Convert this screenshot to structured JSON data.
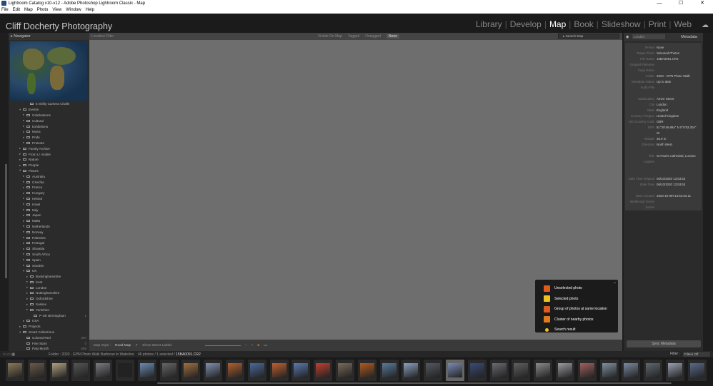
{
  "window": {
    "title": "Lightroom Catalog v10-v12 - Adobe Photoshop Lightroom Classic - Map",
    "controls": [
      "—",
      "☐",
      "✕"
    ]
  },
  "menu": [
    "File",
    "Edit",
    "Map",
    "Photo",
    "View",
    "Window",
    "Help"
  ],
  "identity_plate": "Cliff Docherty Photography",
  "modules": [
    "Library",
    "Develop",
    "Map",
    "Book",
    "Slideshow",
    "Print",
    "Web"
  ],
  "active_module": "Map",
  "left_panel": {
    "navigator_label": "Navigator",
    "tree": [
      {
        "label": "5 Shifty Camera Challe",
        "indent": 3,
        "twisty": ""
      },
      {
        "label": "Events",
        "indent": 1,
        "twisty": "▾"
      },
      {
        "label": "Celebrations",
        "indent": 2,
        "twisty": "▸"
      },
      {
        "label": "Cultural",
        "indent": 2,
        "twisty": "▸"
      },
      {
        "label": "Exhibitions",
        "indent": 2,
        "twisty": "▸"
      },
      {
        "label": "Music",
        "indent": 2,
        "twisty": "▸"
      },
      {
        "label": "Pride",
        "indent": 2,
        "twisty": "▸"
      },
      {
        "label": "Protests",
        "indent": 2,
        "twisty": "▸"
      },
      {
        "label": "Family Archive",
        "indent": 1,
        "twisty": "▸"
      },
      {
        "label": "From Lr mobile",
        "indent": 1,
        "twisty": "▸"
      },
      {
        "label": "Nature",
        "indent": 1,
        "twisty": "▸"
      },
      {
        "label": "People",
        "indent": 1,
        "twisty": "▸"
      },
      {
        "label": "Places",
        "indent": 1,
        "twisty": "▾"
      },
      {
        "label": "Australia",
        "indent": 2,
        "twisty": "▸"
      },
      {
        "label": "Czechia",
        "indent": 2,
        "twisty": "▸"
      },
      {
        "label": "France",
        "indent": 2,
        "twisty": "▸"
      },
      {
        "label": "Hungary",
        "indent": 2,
        "twisty": "▸"
      },
      {
        "label": "Ireland",
        "indent": 2,
        "twisty": "▸"
      },
      {
        "label": "Israel",
        "indent": 2,
        "twisty": "▸"
      },
      {
        "label": "Italy",
        "indent": 2,
        "twisty": "▸"
      },
      {
        "label": "Japan",
        "indent": 2,
        "twisty": "▸"
      },
      {
        "label": "Malta",
        "indent": 2,
        "twisty": "▸"
      },
      {
        "label": "Netherlands",
        "indent": 2,
        "twisty": "▸"
      },
      {
        "label": "Norway",
        "indent": 2,
        "twisty": "▸"
      },
      {
        "label": "Palestine",
        "indent": 2,
        "twisty": "▸"
      },
      {
        "label": "Portugal",
        "indent": 2,
        "twisty": "▸"
      },
      {
        "label": "Slovakia",
        "indent": 2,
        "twisty": "▸"
      },
      {
        "label": "South Africa",
        "indent": 2,
        "twisty": "▸"
      },
      {
        "label": "Spain",
        "indent": 2,
        "twisty": "▸"
      },
      {
        "label": "Sweden",
        "indent": 2,
        "twisty": "▸"
      },
      {
        "label": "UK",
        "indent": 2,
        "twisty": "▾"
      },
      {
        "label": "Buckinghamshire",
        "indent": 3,
        "twisty": "▸"
      },
      {
        "label": "Kent",
        "indent": 3,
        "twisty": "▸"
      },
      {
        "label": "London",
        "indent": 3,
        "twisty": "▸"
      },
      {
        "label": "Nottinghamshire",
        "indent": 3,
        "twisty": "▸"
      },
      {
        "label": "Oxfordshire",
        "indent": 3,
        "twisty": "▸"
      },
      {
        "label": "Sussex",
        "indent": 3,
        "twisty": "▸"
      },
      {
        "label": "Yorkshire",
        "indent": 3,
        "twisty": "▸"
      },
      {
        "label": "P-UK Birmingham",
        "indent": 4,
        "twisty": "",
        "count": "1"
      },
      {
        "label": "USA",
        "indent": 2,
        "twisty": "▸"
      },
      {
        "label": "Projects",
        "indent": 1,
        "twisty": "▸"
      },
      {
        "label": "Smart Collections",
        "indent": 1,
        "twisty": "▾"
      },
      {
        "label": "Colored Red",
        "indent": 2,
        "twisty": "",
        "count": "497"
      },
      {
        "label": "Five Stars",
        "indent": 2,
        "twisty": "",
        "count": "0"
      },
      {
        "label": "Past Month",
        "indent": 2,
        "twisty": "",
        "count": "696"
      }
    ]
  },
  "filter_bar": {
    "label": "Location Filter",
    "options": [
      "Visible On Map",
      "Tagged",
      "Untagged",
      "None"
    ],
    "active_option": "None",
    "search_placeholder": "Search Map"
  },
  "legend": {
    "items": [
      {
        "label": "Unselected photo",
        "color": "#e05a1e"
      },
      {
        "label": "Selected photo",
        "color": "#f0c020"
      },
      {
        "label": "Group of photos at same location",
        "color": "#e05a1e"
      },
      {
        "label": "Cluster of nearby photos",
        "color": "#e07a1e"
      },
      {
        "label": "Search result",
        "color": "#f0c020"
      }
    ],
    "close": "×"
  },
  "map_toolbar": {
    "style_label": "Map Style :",
    "style_value": "Road Map",
    "show_labels": "Show Street Labels",
    "zoom_minus": "−",
    "zoom_plus": "+"
  },
  "right_panel": {
    "preset_select": "London",
    "title": "Metadata",
    "rows": [
      {
        "k": "Preset",
        "v": "None"
      },
      {
        "k": "Target Photo",
        "v": "Selected Photos"
      },
      {
        "k": "File Name",
        "v": "15BA0091.CR2"
      },
      {
        "k": "Original Filename",
        "v": ""
      },
      {
        "k": "Copy Name",
        "v": ""
      },
      {
        "k": "Folder",
        "v": "2020 - GPN Photo Walk"
      },
      {
        "k": "Metadata Status",
        "v": "Up to date"
      },
      {
        "k": "Audio File",
        "v": ""
      },
      {
        "k": "",
        "v": ""
      },
      {
        "k": "Sublocation",
        "v": "Amen Street"
      },
      {
        "k": "City",
        "v": "London"
      },
      {
        "k": "State",
        "v": "England"
      },
      {
        "k": "Country / Region",
        "v": "United Kingdom"
      },
      {
        "k": "ISO Country Code",
        "v": "GBR"
      },
      {
        "k": "GPS",
        "v": "51°30'46.894\" N 0°5'53.304\""
      },
      {
        "k": "",
        "v": "W"
      },
      {
        "k": "Altitude",
        "v": "36.9 m"
      },
      {
        "k": "Direction",
        "v": "North West"
      },
      {
        "k": "",
        "v": ""
      },
      {
        "k": "Title",
        "v": "St Paul's Cathedral, London"
      },
      {
        "k": "Caption",
        "v": ""
      },
      {
        "k": "",
        "v": ""
      },
      {
        "k": "",
        "v": ""
      },
      {
        "k": "Date Time Original",
        "v": "06/10/2020 13:53:53"
      },
      {
        "k": "Date Time",
        "v": "06/10/2020 13:53:53"
      },
      {
        "k": "",
        "v": ""
      },
      {
        "k": "Date Created",
        "v": "2020-10-06T13:53:53.11"
      },
      {
        "k": "Intellectual Genre",
        "v": ""
      },
      {
        "k": "Scene",
        "v": ""
      }
    ],
    "sync_button": "Sync Metadata"
  },
  "filmstrip_bar": {
    "source_prefix": "Folder : 2020 - GPN Photo Walk Barbican to Waterloo",
    "count": "46 photos / 1 selected /",
    "selected_file": "15BA0091.CR2",
    "filter_label": "Filter :",
    "filter_value": "Filters Off"
  },
  "filmstrip": {
    "selected_index": 20,
    "thumb_colors": [
      "#8a7a5a",
      "#6a5a4a",
      "#b0a080",
      "#555",
      "#7a7a80",
      "#222",
      "#6a8ab0",
      "#666",
      "#a07040",
      "#8090b0",
      "#b06030",
      "#4a6a9a",
      "#c06030",
      "#5a7ab0",
      "#c04030",
      "#7a6a5a",
      "#b05a20",
      "#5a7a9a",
      "#8aa0c0",
      "#555a60",
      "#7a8ab0",
      "#3a4a7a",
      "#6a6a70",
      "#606060",
      "#8a8a8a",
      "#9a9aa0",
      "#a06060",
      "#8090a0",
      "#7a8aa0",
      "#606870",
      "#9aa0b0",
      "#5a6a8a"
    ]
  }
}
